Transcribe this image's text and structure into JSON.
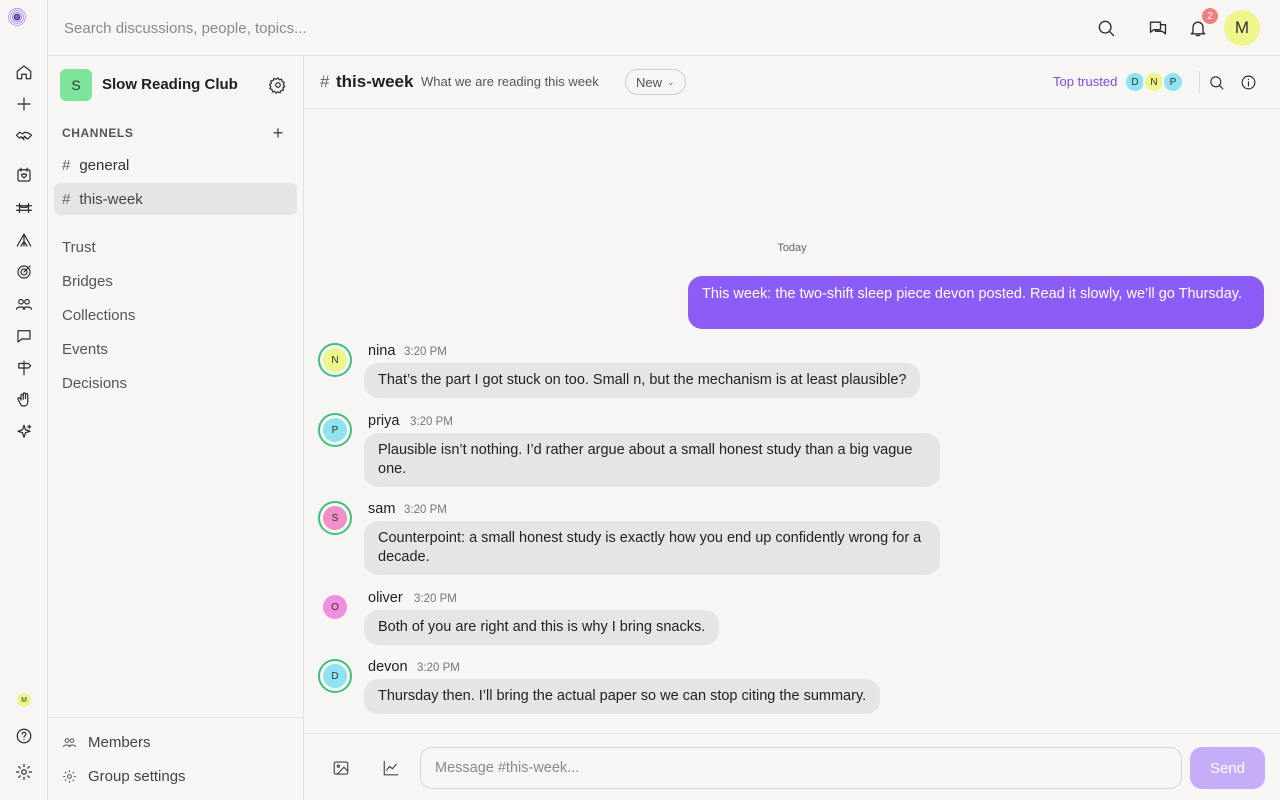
{
  "rail": {
    "avatar_initial": "M",
    "icons": [
      "home-icon",
      "plus-icon",
      "handshake-icon",
      "calendar-heart-icon",
      "bridge-icon",
      "tent-icon",
      "target-icon",
      "people-icon",
      "chat-icon",
      "signpost-icon",
      "hand-icon",
      "sparkle-icon",
      "help-icon",
      "settings-icon"
    ]
  },
  "topbar": {
    "search_placeholder": "Search discussions, people, topics...",
    "notification_count": "2",
    "user_initial": "M"
  },
  "sidebar": {
    "group_initial": "S",
    "group_name": "Slow Reading Club",
    "channels_heading": "CHANNELS",
    "add_symbol": "+",
    "channels": [
      {
        "hash": "#",
        "name": "general"
      },
      {
        "hash": "#",
        "name": "this-week"
      }
    ],
    "nav": [
      "Trust",
      "Bridges",
      "Collections",
      "Events",
      "Decisions"
    ],
    "bottom": {
      "members": "Members",
      "group_settings": "Group settings"
    }
  },
  "channel_header": {
    "hash": "#",
    "title": "this-week",
    "description": "What we are reading this week",
    "sort_label": "New",
    "top_trusted_label": "Top trusted",
    "trusted_avatars": [
      {
        "initial": "D",
        "color": "#8fe3ee"
      },
      {
        "initial": "N",
        "color": "#eef58b"
      },
      {
        "initial": "P",
        "color": "#8fe3ee"
      }
    ]
  },
  "messages": {
    "date_divider": "Today",
    "own_message": "This week: the two-shift sleep piece devon posted. Read it slowly, we’ll go Thursday.",
    "items": [
      {
        "initial": "N",
        "name": "nina",
        "time": "3:20 PM",
        "text": "That’s the part I got stuck on too. Small n, but the mechanism is at least plausible?",
        "color": "#eef58b",
        "trusted": true
      },
      {
        "initial": "P",
        "name": "priya",
        "time": "3:20 PM",
        "text": "Plausible isn’t nothing. I’d rather argue about a small honest study than a big vague one.",
        "color": "#8fe3ee",
        "trusted": true
      },
      {
        "initial": "S",
        "name": "sam",
        "time": "3:20 PM",
        "text": "Counterpoint: a small honest study is exactly how you end up confidently wrong for a decade.",
        "color": "#f08fc8",
        "trusted": true
      },
      {
        "initial": "O",
        "name": "oliver",
        "time": "3:20 PM",
        "text": "Both of you are right and this is why I bring snacks.",
        "color": "#f08fe0",
        "trusted": false
      },
      {
        "initial": "D",
        "name": "devon",
        "time": "3:20 PM",
        "text": "Thursday then. I’ll bring the actual paper so we can stop citing the summary.",
        "color": "#8fe3ee",
        "trusted": true
      }
    ]
  },
  "composer": {
    "placeholder": "Message #this-week...",
    "send_label": "Send"
  },
  "colors": {
    "accent": "#8b5cf6",
    "send_disabled": "#c5aef7",
    "trusted_ring": "#3fc07d",
    "notification": "#f08080"
  }
}
